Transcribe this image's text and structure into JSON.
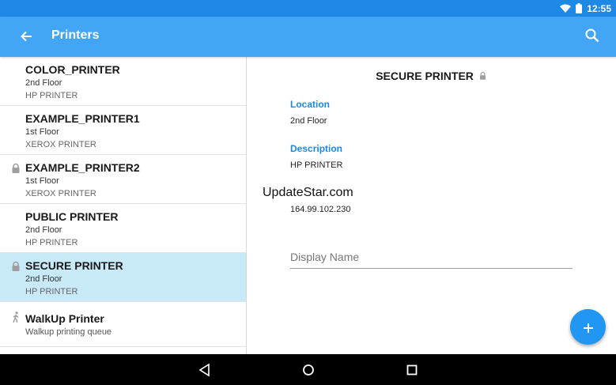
{
  "status_bar": {
    "time": "12:55"
  },
  "app_bar": {
    "title": "Printers"
  },
  "printers": [
    {
      "name": "COLOR_PRINTER",
      "location": "2nd Floor",
      "description": "HP PRINTER",
      "icon": "none"
    },
    {
      "name": "EXAMPLE_PRINTER1",
      "location": "1st Floor",
      "description": "XEROX PRINTER",
      "icon": "none"
    },
    {
      "name": "EXAMPLE_PRINTER2",
      "location": "1st Floor",
      "description": "XEROX PRINTER",
      "icon": "lock-icon"
    },
    {
      "name": "PUBLIC PRINTER",
      "location": "2nd Floor",
      "description": "HP PRINTER",
      "icon": "none"
    },
    {
      "name": "SECURE PRINTER",
      "location": "2nd Floor",
      "description": "HP PRINTER",
      "icon": "lock-icon",
      "selected": true
    },
    {
      "name": "WalkUp Printer",
      "location": "Walkup printing queue",
      "icon": "walk-icon"
    }
  ],
  "detail": {
    "title": "SECURE PRINTER",
    "location_label": "Location",
    "location_value": "2nd Floor",
    "description_label": "Description",
    "description_value": "HP PRINTER",
    "address_value": "164.99.102.230",
    "display_name_placeholder": "Display Name",
    "watermark": "UpdateStar.com"
  },
  "colors": {
    "accent": "#42A5F5",
    "status_bar": "#1E88E5",
    "selected_row": "#C8E9F7",
    "label": "#1E88E5"
  }
}
